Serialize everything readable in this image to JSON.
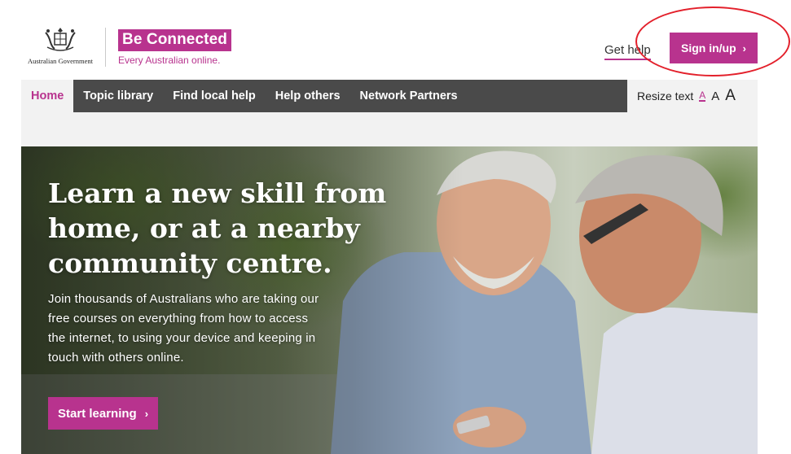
{
  "header": {
    "gov_text": "Australian Government",
    "brand_name": "Be Connected",
    "brand_tagline": "Every Australian online.",
    "get_help": "Get help",
    "sign_in": "Sign in/up",
    "chevron": "›"
  },
  "nav": {
    "items": [
      {
        "label": "Home",
        "active": true
      },
      {
        "label": "Topic library"
      },
      {
        "label": "Find local help"
      },
      {
        "label": "Help others"
      },
      {
        "label": "Network Partners"
      }
    ]
  },
  "resize": {
    "label": "Resize text",
    "small": "A",
    "medium": "A",
    "large": "A"
  },
  "hero": {
    "title": "Learn a new skill from home, or at a nearby community centre.",
    "body": "Join thousands of Australians who are taking our free courses on everything from how to access the internet, to using your device and keeping in touch with others online.",
    "cta": "Start learning",
    "cta_chevron": "›"
  },
  "colors": {
    "brand": "#b8338e",
    "nav_bg": "#4a4a4a",
    "annotation": "#e3202b"
  }
}
